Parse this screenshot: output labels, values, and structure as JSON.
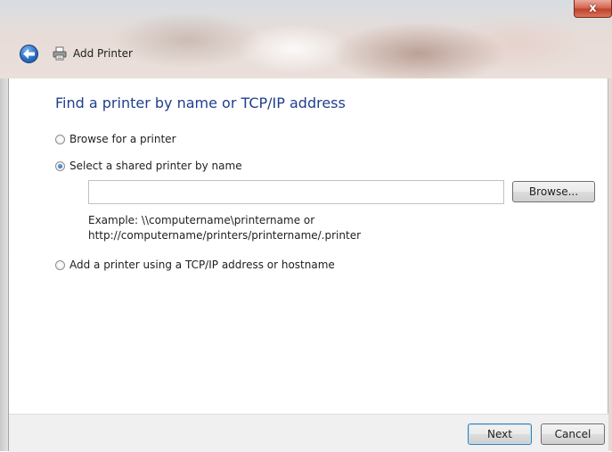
{
  "window": {
    "title": "Add Printer",
    "close_label": "x"
  },
  "main": {
    "heading": "Find a printer by name or TCP/IP address",
    "options": [
      {
        "label": "Browse for a printer",
        "selected": false
      },
      {
        "label": "Select a shared printer by name",
        "selected": true
      },
      {
        "label": "Add a printer using a TCP/IP address or hostname",
        "selected": false
      }
    ],
    "printer_name": {
      "value": "",
      "placeholder": ""
    },
    "browse_label": "Browse...",
    "example_line1": "Example: \\\\computername\\printername or",
    "example_line2": "http://computername/printers/printername/.printer"
  },
  "footer": {
    "next_label": "Next",
    "cancel_label": "Cancel"
  },
  "colors": {
    "heading": "#1f3f8c",
    "back_button": "#2c6ec4",
    "close_button": "#c1432b"
  },
  "icons": {
    "back": "back-arrow-icon",
    "printer": "printer-icon",
    "close": "close-icon"
  }
}
